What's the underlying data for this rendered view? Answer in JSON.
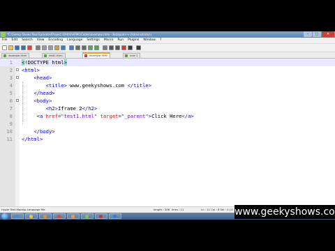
{
  "window": {
    "title": "*C:\\Geeky Shows Raw Episodes\\Project 4\\html\\HTML\\Codes\\example.html - Notepad++ [Administrator]",
    "controls": [
      "–",
      "□",
      "✕"
    ]
  },
  "menu": [
    "File",
    "Edit",
    "Search",
    "View",
    "Encoding",
    "Language",
    "Settings",
    "Macro",
    "Run",
    "Plugins",
    "Window",
    "?"
  ],
  "toolbar": {
    "icons": [
      "new-icon",
      "open-icon",
      "save-icon",
      "save-all-icon",
      "close-icon",
      "print-icon",
      "cut-icon",
      "copy-icon",
      "paste-icon",
      "undo-icon",
      "redo-icon",
      "find-icon",
      "replace-icon",
      "zoom-in-icon",
      "zoom-out-icon",
      "sync-icon",
      "wrap-icon",
      "indent-icon",
      "macro-record-icon",
      "macro-stop-icon",
      "macro-play-icon"
    ]
  },
  "tabs": [
    {
      "label": "example.html",
      "active": false
    },
    {
      "label": "test1.html",
      "active": false
    },
    {
      "label": "example.html",
      "active": true
    },
    {
      "label": "new 1",
      "active": false
    }
  ],
  "editor": {
    "current_line": 1,
    "lines": [
      {
        "num": "1",
        "segments": [
          {
            "t": "<",
            "c": "hl"
          },
          {
            "t": "!DOCTYPE html",
            "c": "doc"
          },
          {
            "t": ">",
            "c": "hl"
          }
        ]
      },
      {
        "num": "2",
        "fold": true,
        "segments": [
          {
            "t": "<html>",
            "c": "tag"
          }
        ]
      },
      {
        "num": "3",
        "fold": true,
        "segments": [
          {
            "t": "    ",
            "c": "txt"
          },
          {
            "t": "<head>",
            "c": "tag"
          }
        ]
      },
      {
        "num": "4",
        "segments": [
          {
            "t": "        ",
            "c": "txt"
          },
          {
            "t": "<title>",
            "c": "tag"
          },
          {
            "t": " www.geekyshows.com ",
            "c": "txt"
          },
          {
            "t": "</title>",
            "c": "tag"
          }
        ]
      },
      {
        "num": "5",
        "segments": [
          {
            "t": "    ",
            "c": "txt"
          },
          {
            "t": "</head>",
            "c": "tag"
          }
        ]
      },
      {
        "num": "6",
        "fold": true,
        "segments": [
          {
            "t": "    ",
            "c": "txt"
          },
          {
            "t": "<body>",
            "c": "tag"
          }
        ]
      },
      {
        "num": "7",
        "segments": [
          {
            "t": "        ",
            "c": "txt"
          },
          {
            "t": "<h2>",
            "c": "tag"
          },
          {
            "t": "Iframe 2",
            "c": "txt"
          },
          {
            "t": "</h2>",
            "c": "tag"
          }
        ]
      },
      {
        "num": "8",
        "segments": [
          {
            "t": "     ",
            "c": "txt"
          },
          {
            "t": "<a ",
            "c": "tag"
          },
          {
            "t": "href",
            "c": "attr"
          },
          {
            "t": "=",
            "c": "tag"
          },
          {
            "t": "\"test1.html\"",
            "c": "val"
          },
          {
            "t": " target",
            "c": "attr"
          },
          {
            "t": "=",
            "c": "tag"
          },
          {
            "t": "\"_parent\"",
            "c": "val"
          },
          {
            "t": ">",
            "c": "tag"
          },
          {
            "t": "Click Here",
            "c": "txt"
          },
          {
            "t": "</a>",
            "c": "tag"
          }
        ]
      },
      {
        "num": "9",
        "segments": []
      },
      {
        "num": "10",
        "segments": [
          {
            "t": "    ",
            "c": "txt"
          },
          {
            "t": "</body>",
            "c": "tag"
          }
        ]
      },
      {
        "num": "11",
        "segments": [
          {
            "t": "</html>",
            "c": "tag"
          }
        ]
      }
    ]
  },
  "status": {
    "language": "Hyper Text Markup Language file",
    "length": "length : 308",
    "lines": "lines : 11",
    "position": "Ln : 11    Col : 8    Sel : 0 | 0",
    "eol": "Dos\\Windows",
    "encoding": "UTF-8 w/o BOM",
    "mode": "INS"
  },
  "taskbar": {
    "apps": [
      {
        "name": "ie-icon",
        "color": "#3b8fe0"
      },
      {
        "name": "folder-icon",
        "color": "#f1c34a"
      },
      {
        "name": "media-icon",
        "color": "#f08a24"
      },
      {
        "name": "chrome-icon",
        "color": "#e04a3a"
      },
      {
        "name": "firefox-icon",
        "color": "#f29b30"
      },
      {
        "name": "notepadpp-icon",
        "color": "#8bc34a"
      },
      {
        "name": "app-icon",
        "color": "#c0392b"
      },
      {
        "name": "app2-icon",
        "color": "#2d7dd2"
      }
    ]
  },
  "watermark": "www.geekyshows.com"
}
